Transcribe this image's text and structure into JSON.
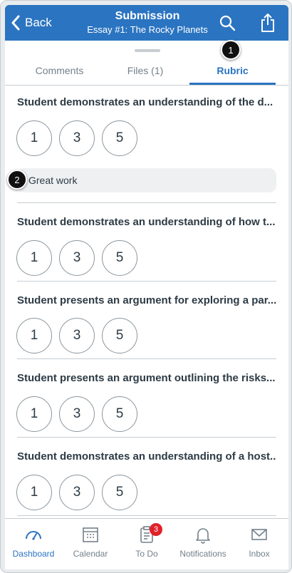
{
  "header": {
    "back_label": "Back",
    "title": "Submission",
    "subtitle": "Essay #1: The Rocky Planets"
  },
  "tabs": [
    {
      "label": "Comments"
    },
    {
      "label": "Files (1)"
    },
    {
      "label": "Rubric"
    }
  ],
  "rubric": [
    {
      "title": "Student demonstrates an understanding of the d...",
      "ratings": [
        "1",
        "3",
        "5"
      ],
      "comment": "Great work"
    },
    {
      "title": "Student demonstrates an understanding of how t...",
      "ratings": [
        "1",
        "3",
        "5"
      ]
    },
    {
      "title": "Student presents an argument for exploring a par...",
      "ratings": [
        "1",
        "3",
        "5"
      ]
    },
    {
      "title": "Student presents an argument outlining the risks...",
      "ratings": [
        "1",
        "3",
        "5"
      ]
    },
    {
      "title": "Student demonstrates an understanding of a host...",
      "ratings": [
        "1",
        "3",
        "5"
      ]
    }
  ],
  "callouts": [
    "1",
    "2"
  ],
  "tabbar": [
    {
      "label": "Dashboard",
      "icon": "dashboard-icon"
    },
    {
      "label": "Calendar",
      "icon": "calendar-icon"
    },
    {
      "label": "To Do",
      "icon": "todo-icon",
      "badge": "3"
    },
    {
      "label": "Notifications",
      "icon": "bell-icon"
    },
    {
      "label": "Inbox",
      "icon": "inbox-icon"
    }
  ],
  "colors": {
    "brand": "#2b74c1",
    "badge": "#e0212a"
  }
}
